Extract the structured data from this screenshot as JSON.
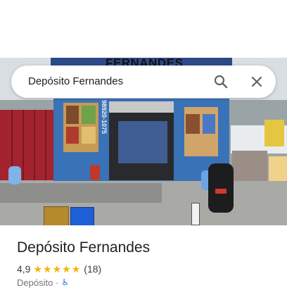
{
  "search": {
    "query": "Depósito Fernandes"
  },
  "photo": {
    "sign_text": "FERNANDES",
    "phone_text": "98920-1075"
  },
  "place": {
    "title": "Depósito Fernandes",
    "rating": "4,9",
    "stars": 5,
    "review_count": "(18)",
    "category": "Depósito ·"
  },
  "icons": {
    "search": "search-icon",
    "close": "close-icon",
    "star": "star-icon",
    "accessibility": "wheelchair-icon"
  },
  "colors": {
    "star": "#f4b400",
    "accent": "#1a73e8",
    "text_primary": "#202124",
    "text_secondary": "#70757a"
  }
}
